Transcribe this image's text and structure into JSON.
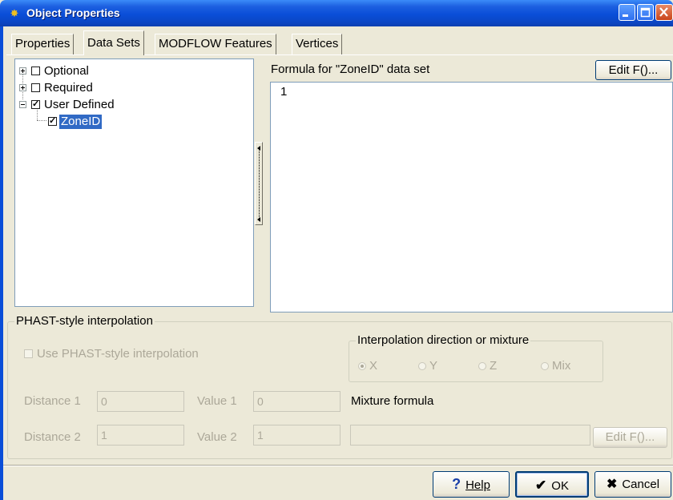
{
  "window": {
    "title": "Object Properties",
    "title_icon": "bug-icon"
  },
  "tabs": [
    {
      "label": "Properties",
      "active": false
    },
    {
      "label": "Data Sets",
      "active": true
    },
    {
      "label": "MODFLOW Features",
      "active": false
    },
    {
      "label": "Vertices",
      "active": false
    }
  ],
  "tree": {
    "items": [
      {
        "label": "Optional",
        "checked": false,
        "expanded": false
      },
      {
        "label": "Required",
        "checked": false,
        "expanded": false
      },
      {
        "label": "User Defined",
        "checked": true,
        "expanded": true
      },
      {
        "label": "ZoneID",
        "checked": true,
        "selected": true
      }
    ]
  },
  "formula": {
    "label": "Formula for \"ZoneID\" data set",
    "edit_button": "Edit F()...",
    "value": "1"
  },
  "phast": {
    "group_label": "PHAST-style interpolation",
    "use_checkbox_label": "Use PHAST-style interpolation",
    "use_checked": false,
    "direction_group_label": "Interpolation direction or mixture",
    "directions": [
      "X",
      "Y",
      "Z",
      "Mix"
    ],
    "selected_direction": "X",
    "distance1_label": "Distance 1",
    "distance1_value": "0",
    "distance2_label": "Distance 2",
    "distance2_value": "1",
    "value1_label": "Value 1",
    "value1_value": "0",
    "value2_label": "Value 2",
    "value2_value": "1",
    "mixture_label": "Mixture formula",
    "mixture_value": "",
    "mixture_edit_button": "Edit F()..."
  },
  "buttons": {
    "help": "Help",
    "ok": "OK",
    "cancel": "Cancel"
  },
  "colors": {
    "titlebar": "#0a4ed8",
    "selection": "#316ac5",
    "face": "#ece9d8"
  }
}
